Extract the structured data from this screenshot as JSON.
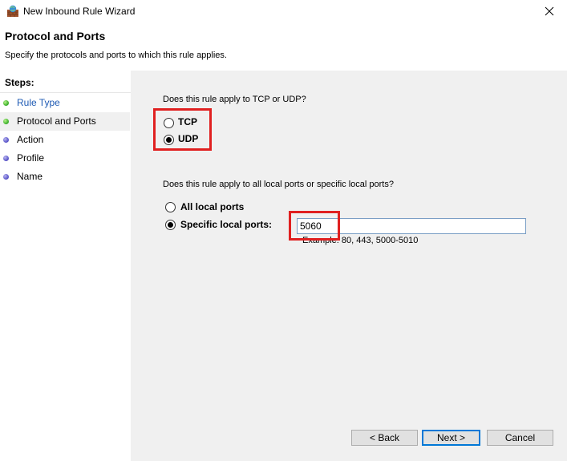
{
  "window": {
    "title": "New Inbound Rule Wizard",
    "icon": "firewall-shield-icon"
  },
  "header": {
    "title": "Protocol and Ports",
    "description": "Specify the protocols and ports to which this rule applies."
  },
  "steps": {
    "title": "Steps:",
    "items": [
      {
        "label": "Rule Type",
        "status": "done"
      },
      {
        "label": "Protocol and Ports",
        "status": "current"
      },
      {
        "label": "Action",
        "status": "pending"
      },
      {
        "label": "Profile",
        "status": "pending"
      },
      {
        "label": "Name",
        "status": "pending"
      }
    ]
  },
  "protocol": {
    "question": "Does this rule apply to TCP or UDP?",
    "options": [
      {
        "label": "TCP",
        "selected": false
      },
      {
        "label": "UDP",
        "selected": true
      }
    ]
  },
  "ports": {
    "question": "Does this rule apply to all local ports or specific local ports?",
    "options": [
      {
        "label": "All local ports",
        "selected": false
      },
      {
        "label": "Specific local ports:",
        "selected": true
      }
    ],
    "value": "5060",
    "example": "Example: 80, 443, 5000-5010"
  },
  "buttons": {
    "back": "< Back",
    "next": "Next >",
    "cancel": "Cancel"
  },
  "colors": {
    "highlight": "#e02020",
    "link": "#1f5bb4",
    "done_dot": "#3cb02b",
    "pending_dot": "#5a55c9"
  }
}
